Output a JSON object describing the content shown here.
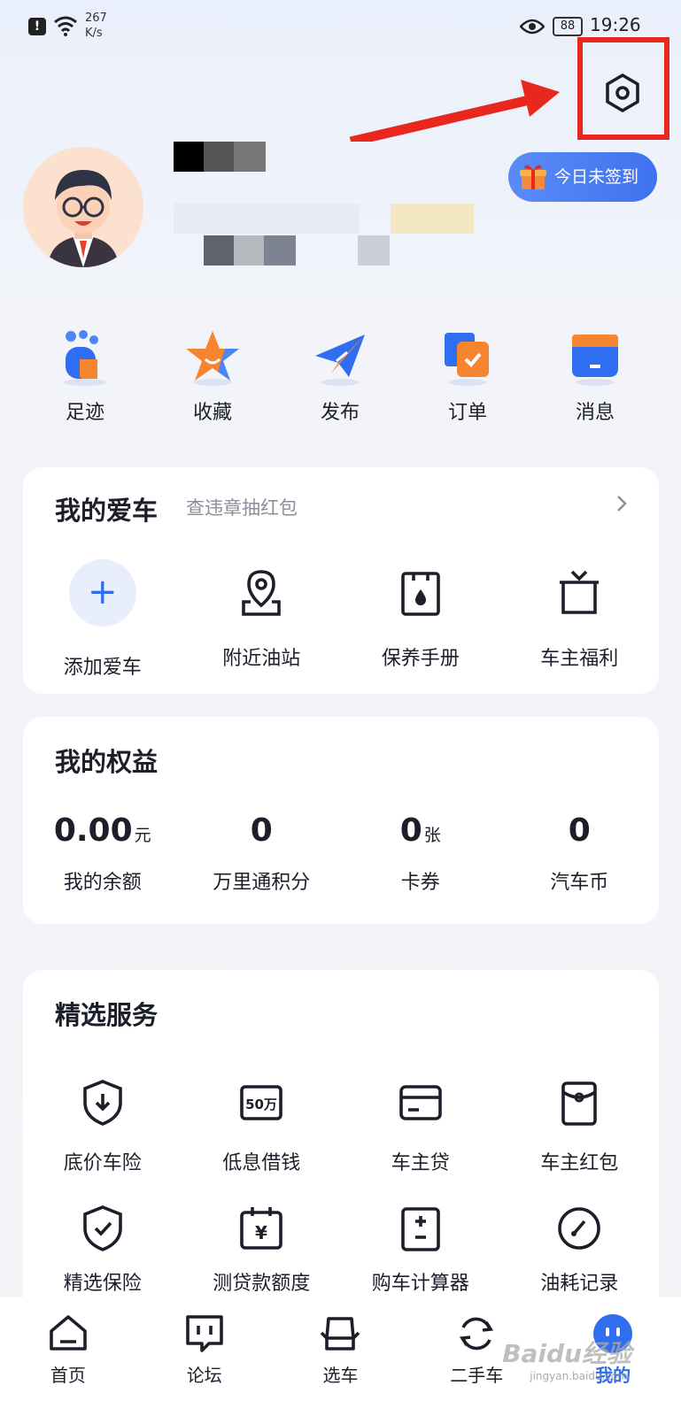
{
  "status_bar": {
    "network_speed_value": "267",
    "network_speed_unit": "K/s",
    "battery": "88",
    "time": "19:26"
  },
  "profile": {
    "signin_label": "今日未签到"
  },
  "quick_actions": [
    {
      "label": "足迹",
      "icon": "footprint-icon"
    },
    {
      "label": "收藏",
      "icon": "star-icon"
    },
    {
      "label": "发布",
      "icon": "paper-plane-icon"
    },
    {
      "label": "订单",
      "icon": "order-icon"
    },
    {
      "label": "消息",
      "icon": "message-icon"
    }
  ],
  "my_car": {
    "title": "我的爱车",
    "subtitle": "查违章抽红包",
    "items": [
      {
        "label": "添加爱车",
        "icon": "plus-icon"
      },
      {
        "label": "附近油站",
        "icon": "location-pin-icon"
      },
      {
        "label": "保养手册",
        "icon": "manual-icon"
      },
      {
        "label": "车主福利",
        "icon": "gift-box-icon"
      }
    ]
  },
  "benefits": {
    "title": "我的权益",
    "items": [
      {
        "value": "0.00",
        "unit": "元",
        "label": "我的余额"
      },
      {
        "value": "0",
        "unit": "",
        "label": "万里通积分"
      },
      {
        "value": "0",
        "unit": "张",
        "label": "卡券"
      },
      {
        "value": "0",
        "unit": "",
        "label": "汽车币"
      }
    ]
  },
  "services": {
    "title": "精选服务",
    "row1": [
      {
        "label": "底价车险",
        "icon": "shield-download-icon"
      },
      {
        "label": "低息借钱",
        "icon": "loan-50w-icon"
      },
      {
        "label": "车主贷",
        "icon": "card-icon"
      },
      {
        "label": "车主红包",
        "icon": "red-envelope-icon"
      }
    ],
    "row2": [
      {
        "label": "精选保险",
        "icon": "shield-check-icon"
      },
      {
        "label": "测贷款额度",
        "icon": "calendar-yuan-icon"
      },
      {
        "label": "购车计算器",
        "icon": "calculator-icon"
      },
      {
        "label": "油耗记录",
        "icon": "gauge-icon"
      }
    ]
  },
  "bottom_nav": [
    {
      "label": "首页",
      "icon": "home-icon"
    },
    {
      "label": "论坛",
      "icon": "forum-icon"
    },
    {
      "label": "选车",
      "icon": "car-seat-icon"
    },
    {
      "label": "二手车",
      "icon": "refresh-icon"
    },
    {
      "label": "我的",
      "icon": "profile-face-icon",
      "active": true
    }
  ],
  "watermark": {
    "text": "Baidu经验",
    "sub": "jingyan.baidu.com"
  },
  "colors": {
    "accent": "#2f6ef0",
    "highlight_box": "#e8281e",
    "orange": "#f36b2b"
  }
}
